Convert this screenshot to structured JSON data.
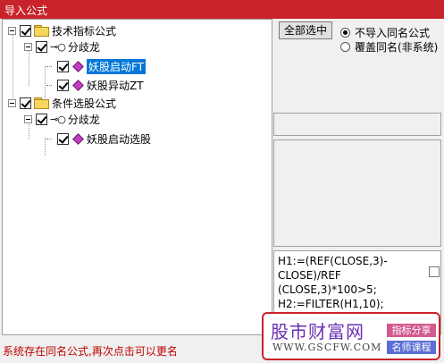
{
  "window": {
    "title": "导入公式"
  },
  "tree": {
    "groups": [
      {
        "label": "技术指标公式",
        "author": "分歧龙",
        "items": [
          "妖股启动FT",
          "妖股异动ZT"
        ]
      },
      {
        "label": "条件选股公式",
        "author": "分歧龙",
        "items": [
          "妖股启动选股"
        ]
      }
    ]
  },
  "status_text": "系统存在同名公式,再次点击可以更名",
  "right": {
    "select_all_label": "全部选中",
    "radio_no_import": "不导入同名公式",
    "radio_overwrite": "覆盖同名(非系统)"
  },
  "formula": {
    "lines": [
      "H1:=(REF(CLOSE,3)-",
      "CLOSE)/REF",
      "(CLOSE,3)*100>5;",
      "H2:=FILTER(H1,10);"
    ]
  },
  "watermark": {
    "title": "股市财富网",
    "url": "WWW.GSCFW.COM",
    "tag1": "指标分享",
    "tag2": "名师课程"
  }
}
